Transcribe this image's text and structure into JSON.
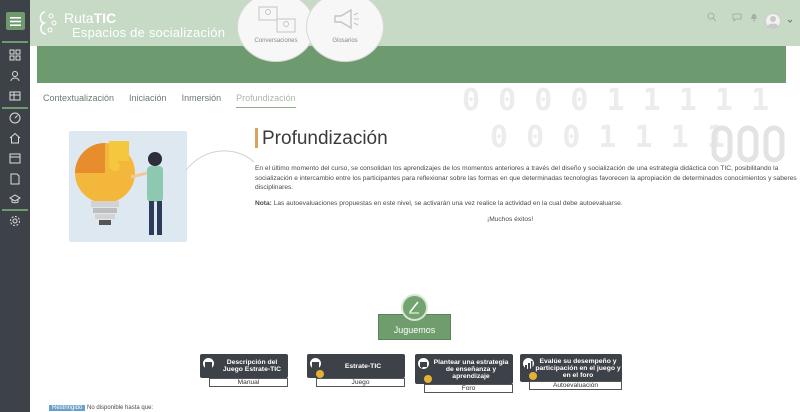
{
  "header": {
    "logo_prefix": "Ruta",
    "logo_bold": "TIC",
    "site_subtitle": "Espacios de socialización",
    "circles": [
      {
        "label": "Conversaciones"
      },
      {
        "label": "Glosarios"
      }
    ]
  },
  "tabs": [
    {
      "label": "Contextualización"
    },
    {
      "label": "Iniciación"
    },
    {
      "label": "Inmersión"
    },
    {
      "label": "Profundización"
    }
  ],
  "section": {
    "title": "Profundización",
    "paragraph": "En el último momento del curso, se consolidan los aprendizajes de los momentos anteriores a través del diseño y socialización de una estrategia didáctica con TIC, posibilitando la socialización e intercambio entre los participantes para reflexionar sobre las formas en que determinadas tecnologías favorecen la apropiación de determinados conocimientos y saberes disciplinares.",
    "note_label": "Nota:",
    "note_text": " Las autoevaluaciones propuestas en este nivel, se activarán una vez realice la actividad en la cual debe autoevaluarse.",
    "cheer": "¡Muchos éxitos!"
  },
  "play": {
    "button_label": "Juguemos"
  },
  "activities": [
    {
      "title": "Descripción del Juego Estrate-TIC",
      "type": "Manual"
    },
    {
      "title": "Estrate-TIC",
      "type": "Juego"
    },
    {
      "title": "Plantear una estrategia de enseñanza y aprendizaje",
      "type": "Foro"
    },
    {
      "title": "Evalúe su desempeño y participación en el juego y en el foro",
      "type": "Autoevaluación"
    }
  ],
  "restriction": {
    "pill": "Restringido",
    "text": "No disponible hasta que:"
  },
  "colors": {
    "accent_green": "#6e9a70",
    "rail": "#3d4249",
    "title_marker": "#d8a35c"
  }
}
